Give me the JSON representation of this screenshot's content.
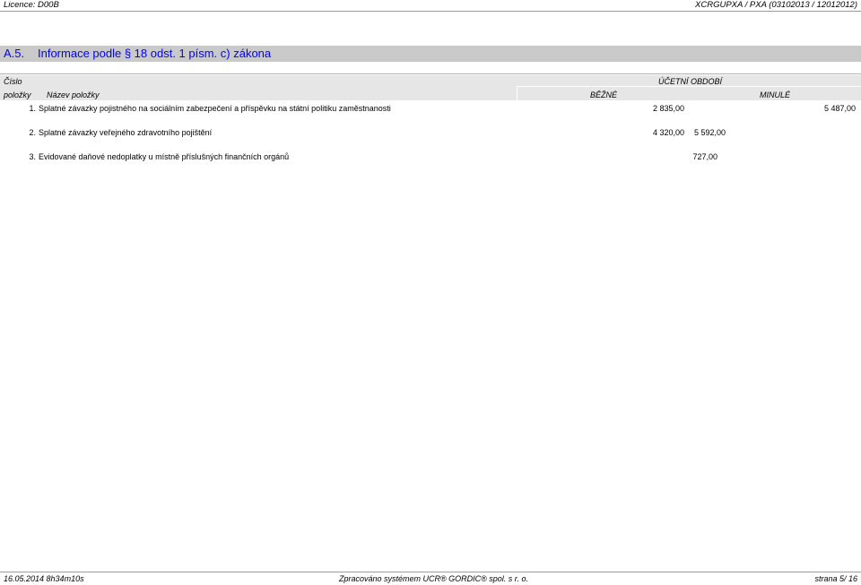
{
  "header": {
    "licence": "Licence: D00B",
    "report_code": "XCRGUPXA / PXA  (03102013 / 12012012)"
  },
  "section": {
    "number": "A.5.",
    "title": "Informace podle § 18 odst. 1 písm. c) zákona"
  },
  "table": {
    "col_number_line1": "Číslo",
    "col_number_line2": "položky",
    "col_name": "Název položky",
    "period_group": "ÚČETNÍ OBDOBÍ",
    "col_current": "BĚŽNÉ",
    "col_previous": "MINULÉ",
    "rows": [
      {
        "number": "1.",
        "name": "Splatné závazky pojistného na sociálním zabezpečení a příspěvku na státní politiku zaměstnanosti",
        "current": "2 835,00",
        "previous": "5 487,00"
      },
      {
        "number": "2.",
        "name": "Splatné závazky veřejného zdravotního pojištění",
        "current": "4 320,00",
        "previous": "5 592,00"
      },
      {
        "number": "3.",
        "name": "Evidované daňové nedoplatky u místně příslušných finančních orgánů",
        "current": "727,00",
        "previous": ""
      }
    ]
  },
  "footer": {
    "timestamp": "16.05.2014 8h34m10s",
    "processed_by": "Zpracováno systémem  UCR® GORDIC® spol. s  r. o.",
    "page": "strana 5/ 16"
  }
}
